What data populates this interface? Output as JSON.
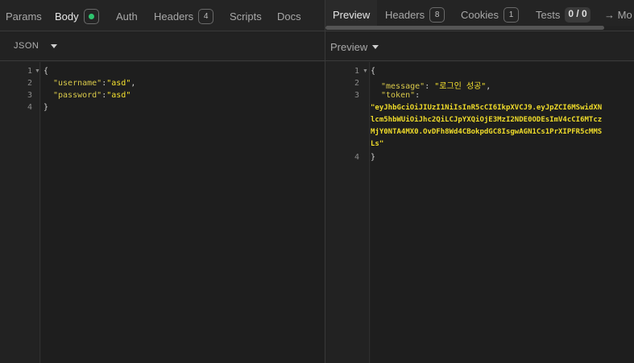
{
  "request": {
    "tabs": [
      {
        "label": "Params"
      },
      {
        "label": "Body"
      },
      {
        "label": "Auth"
      },
      {
        "label": "Headers",
        "count": "4"
      },
      {
        "label": "Scripts"
      },
      {
        "label": "Docs"
      }
    ],
    "body_mode": "JSON",
    "body_lines": [
      "1",
      "2",
      "3",
      "4"
    ],
    "body": {
      "open": "{",
      "username_key": "\"username\"",
      "username_val": "\"asd\"",
      "password_key": "\"password\"",
      "password_val": "\"asd\"",
      "close": "}"
    },
    "status_color": "#2ec46f"
  },
  "response": {
    "tabs": [
      {
        "label": "Preview"
      },
      {
        "label": "Headers",
        "count": "8"
      },
      {
        "label": "Cookies",
        "count": "1"
      },
      {
        "label": "Tests",
        "count": "0 / 0"
      },
      {
        "label": "→ Mo"
      }
    ],
    "preview_mode": "Preview",
    "lines": [
      "1",
      "2",
      "3",
      "4"
    ],
    "json": {
      "open": "{",
      "message_key": "\"message\"",
      "message_val": "\"로그인 성공\"",
      "token_key": "\"token\"",
      "token_lines": [
        "\"eyJhbGciOiJIUzI1NiIsInR5cCI6IkpXVCJ9.eyJpZCI6MSwidXN",
        "lcm5hbWUiOiJhc2QiLCJpYXQiOjE3MzI2NDE0ODEsImV4cCI6MTcz",
        "MjY0NTA4MX0.OvDFh8Wd4CBokpdGC8IsgwAGN1Cs1PrXIPFR5cMMS",
        "Ls\""
      ],
      "close": "}"
    }
  }
}
